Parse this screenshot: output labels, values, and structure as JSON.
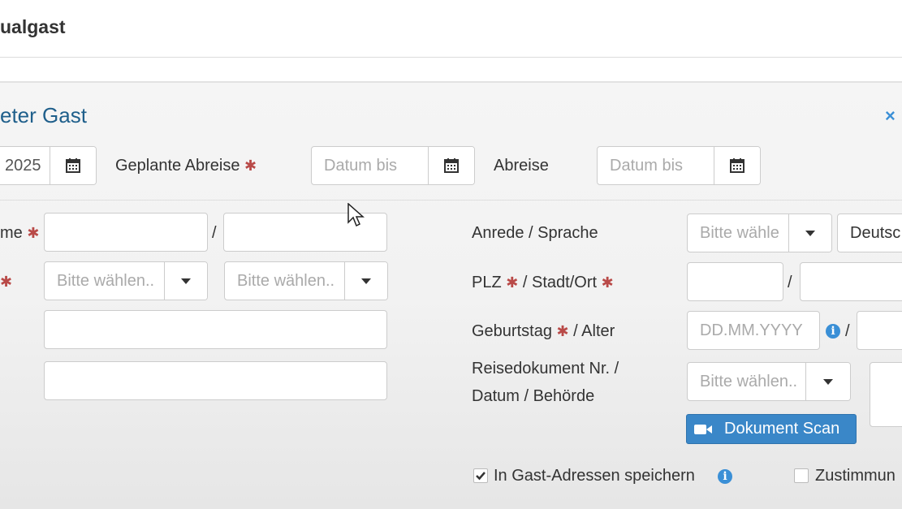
{
  "header": {
    "title": "ualgast"
  },
  "dialog": {
    "title": "eter Gast",
    "close_symbol": "×",
    "arrival_date_value": "2025",
    "planned_departure": {
      "label": "Geplante Abreise",
      "placeholder": "Datum bis"
    },
    "departure": {
      "label": "Abreise",
      "placeholder": "Datum bis"
    }
  },
  "left_form": {
    "name_label": "me",
    "required_mark": "✱",
    "separator": "/",
    "select_placeholder_1": "Bitte wählen..",
    "select_placeholder_2": "Bitte wählen.."
  },
  "right_form": {
    "salutation_label": "Anrede / Sprache",
    "salutation_placeholder": "Bitte wähle",
    "language_value": "Deutsc",
    "plz_label": "PLZ",
    "city_label": "/ Stadt/Ort",
    "birthday_label": "Geburtstag",
    "age_label": "/ Alter",
    "birthday_placeholder": "DD.MM.YYYY",
    "travel_doc_label_line1": "Reisedokument Nr. /",
    "travel_doc_label_line2": "Datum / Behörde",
    "travel_doc_placeholder": "Bitte wählen..",
    "scan_button_label": "Dokument Scan"
  },
  "checkboxes": {
    "save_address": {
      "label": "In Gast-Adressen speichern",
      "checked": true
    },
    "consent": {
      "label": "Zustimmun",
      "checked": false
    }
  },
  "icons": {
    "calendar": "calendar-icon",
    "caret": "caret-down-icon",
    "info": "info-icon",
    "video": "video-camera-icon"
  },
  "colors": {
    "title": "#1f5f8b",
    "accent": "#3a87c8",
    "required": "#b94a48"
  }
}
